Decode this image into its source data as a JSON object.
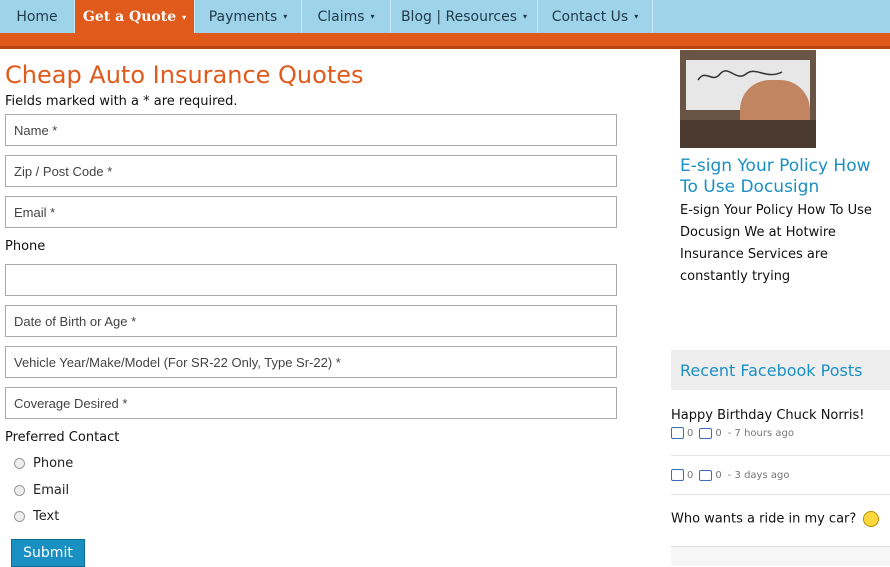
{
  "nav": {
    "items": [
      {
        "label": "Home",
        "has_caret": false
      },
      {
        "label": "Get a Quote",
        "has_caret": true
      },
      {
        "label": "Payments",
        "has_caret": true
      },
      {
        "label": "Claims",
        "has_caret": true
      },
      {
        "label": "Blog | Resources",
        "has_caret": true
      },
      {
        "label": "Contact Us",
        "has_caret": true
      }
    ],
    "active_index": 1,
    "caret": "▾"
  },
  "form": {
    "title": "Cheap Auto Insurance Quotes",
    "required_note": "Fields marked with a * are required.",
    "name_placeholder": "Name *",
    "zip_placeholder": "Zip / Post Code *",
    "email_placeholder": "Email *",
    "phone_label": "Phone",
    "phone_value": "",
    "dob_placeholder": "Date of Birth or Age *",
    "vehicle_placeholder": "Vehicle Year/Make/Model (For SR-22 Only, Type Sr-22) *",
    "coverage_placeholder": "Coverage Desired *",
    "preferred_contact_label": "Preferred Contact",
    "contact_options": [
      "Phone",
      "Email",
      "Text"
    ],
    "submit_label": "Submit"
  },
  "sidebar": {
    "post_title": "E-sign Your Policy How To Use Docusign",
    "post_excerpt": "E-sign Your Policy How To Use Docusign We at Hotwire Insurance Services are constantly trying",
    "facebook_header": "Recent Facebook Posts",
    "fb_posts": [
      {
        "text": "Happy Birthday Chuck Norris!",
        "likes": "0",
        "comments": "0",
        "time": "- 7 hours ago"
      },
      {
        "text": "",
        "likes": "0",
        "comments": "0",
        "time": "- 3 days ago"
      },
      {
        "text": "Who wants a ride in my car?",
        "likes": "",
        "comments": "",
        "time": ""
      }
    ]
  },
  "colors": {
    "nav_bg": "#9fd3ea",
    "accent_orange": "#e05a1b",
    "link_blue": "#1a8fc2"
  }
}
